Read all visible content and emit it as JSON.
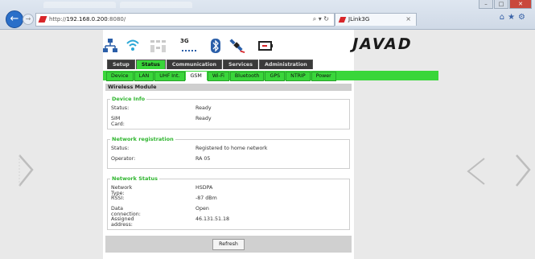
{
  "browser": {
    "url_prefix": "http://",
    "url_host": "192.168.0.200",
    "url_suffix": ":8080/",
    "address_controls": "⌕ ▾ ↻",
    "tab_title": "JLink3G",
    "tab_close": "×",
    "back_glyph": "←",
    "forward_glyph": "→",
    "window_minimize": "–",
    "window_maximize": "□",
    "window_close": "✕",
    "tool_icons": "⌂★⚙"
  },
  "icons": [
    "network-icon",
    "wifi-icon",
    "uhf-icon",
    "3g-signal-icon",
    "bluetooth-icon",
    "satellite-icon",
    "battery-icon"
  ],
  "icon_text": {
    "3g": "3G"
  },
  "brand": {
    "logo": "JAVAD"
  },
  "nav": {
    "main_tabs": [
      "Setup",
      "Status",
      "Communication",
      "Services",
      "Administration"
    ],
    "main_active": "Status",
    "sub_tabs": [
      "Device",
      "LAN",
      "UHF Int.",
      "GSM",
      "Wi-Fi",
      "Bluetooth",
      "GPS",
      "NTRIP",
      "Power"
    ],
    "sub_active": "GSM"
  },
  "panel": {
    "title": "Wireless Module",
    "device_info": {
      "legend": "Device Info",
      "status_label": "Status:",
      "status_value": "Ready",
      "sim_label": "SIM Card:",
      "sim_value": "Ready"
    },
    "network_registration": {
      "legend": "Network registration",
      "status_label": "Status:",
      "status_value": "Registered to home network",
      "operator_label": "Operator:",
      "operator_value": "RA 05"
    },
    "network_status": {
      "legend": "Network Status",
      "type_label": "Network Type:",
      "type_value": "HSDPA",
      "rssi_label": "RSSI:",
      "rssi_value": "-87 dBm",
      "data_label": "Data connection:",
      "data_value": "Open",
      "address_label": "Assigned address:",
      "address_value": "46.131.51.18"
    },
    "refresh_label": "Refresh"
  },
  "colors": {
    "accent_green": "#39d63a",
    "legend_green": "#2fb52f",
    "tab_dark": "#3a3a3a"
  }
}
